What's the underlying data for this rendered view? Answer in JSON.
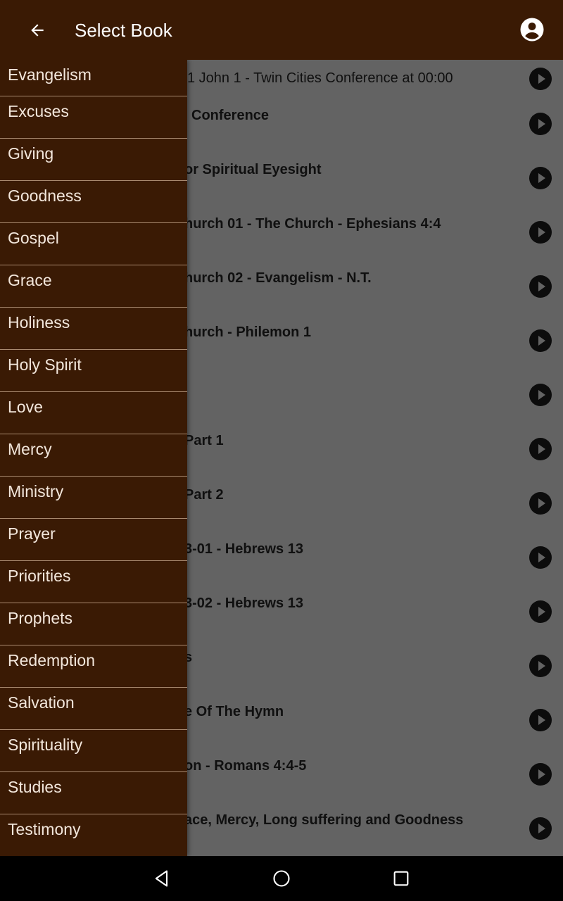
{
  "appbar": {
    "title": "Select Book",
    "back_icon": "arrow-left-icon",
    "account_icon": "account-circle-icon",
    "color": "#3a1a04"
  },
  "drawer": {
    "items": [
      {
        "label": "Evangelism"
      },
      {
        "label": "Excuses"
      },
      {
        "label": "Giving"
      },
      {
        "label": "Goodness"
      },
      {
        "label": "Gospel"
      },
      {
        "label": "Grace"
      },
      {
        "label": "Holiness"
      },
      {
        "label": "Holy Spirit"
      },
      {
        "label": "Love"
      },
      {
        "label": "Mercy"
      },
      {
        "label": "Ministry"
      },
      {
        "label": "Prayer"
      },
      {
        "label": "Priorities"
      },
      {
        "label": "Prophets"
      },
      {
        "label": "Redemption"
      },
      {
        "label": "Salvation"
      },
      {
        "label": "Spirituality"
      },
      {
        "label": "Studies"
      },
      {
        "label": "Testimony"
      }
    ]
  },
  "list": {
    "items": [
      {
        "title": "1 John 1 - Twin Cities Conference at 00:00",
        "visible_fragment": "1 John 1 - Twin Cities Conference at 00:00",
        "bold": false
      },
      {
        "title": "Conference",
        "visible_fragment": "Conference",
        "bold": true
      },
      {
        "title": "or Spiritual Eyesight",
        "visible_fragment": "or Spiritual Eyesight",
        "bold": true
      },
      {
        "title": "hurch 01 - The Church - Ephesians 4:4",
        "visible_fragment": "hurch 01 - The Church - Ephesians 4:4",
        "bold": true
      },
      {
        "title": "hurch 02 - Evangelism - N.T.",
        "visible_fragment": "hurch 02 - Evangelism - N.T.",
        "bold": true
      },
      {
        "title": "hurch - Philemon 1",
        "visible_fragment": "hurch - Philemon 1",
        "bold": true
      },
      {
        "title": "",
        "visible_fragment": "",
        "bold": true
      },
      {
        "title": "Part 1",
        "visible_fragment": "Part 1",
        "bold": true
      },
      {
        "title": "Part 2",
        "visible_fragment": "Part 2",
        "bold": true
      },
      {
        "title": "3-01 - Hebrews 13",
        "visible_fragment": "3-01 - Hebrews 13",
        "bold": true
      },
      {
        "title": "3-02 - Hebrews 13",
        "visible_fragment": "3-02 - Hebrews 13",
        "bold": true
      },
      {
        "title": "s",
        "visible_fragment": "s",
        "bold": true
      },
      {
        "title": "e Of The Hymn",
        "visible_fragment": "e Of The Hymn",
        "bold": true
      },
      {
        "title": "on - Romans 4:4-5",
        "visible_fragment": "on - Romans 4:4-5",
        "bold": true
      },
      {
        "title": "ace, Mercy, Long suffering and Goodness",
        "visible_fragment": "ace, Mercy, Long suffering and Goodness",
        "bold": true
      }
    ],
    "play_icon": "play-circle-icon"
  },
  "navbar": {
    "back_icon": "nav-back-icon",
    "home_icon": "nav-home-icon",
    "recents_icon": "nav-recents-icon"
  }
}
